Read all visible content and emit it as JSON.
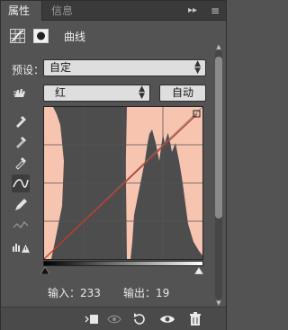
{
  "tabs": [
    {
      "label": "属性",
      "active": true
    },
    {
      "label": "信息",
      "active": false
    }
  ],
  "tab_controls": {
    "collapse": "▸▸",
    "menu": "≡"
  },
  "header": {
    "title": "曲线",
    "icons": [
      "curves-adjustment-icon",
      "layer-mask-icon"
    ]
  },
  "preset": {
    "label": "预设：",
    "value": "自定"
  },
  "channel": {
    "value": "红"
  },
  "auto_button": "自动",
  "tools": [
    "target-adjust-icon",
    "black-eyedropper-icon",
    "gray-eyedropper-icon",
    "white-eyedropper-icon",
    "curve-edit-icon",
    "pencil-draw-icon",
    "smooth-icon",
    "clipping-warning-icon"
  ],
  "input": {
    "label": "输入：",
    "value": "233"
  },
  "output": {
    "label": "输出：",
    "value": "19"
  },
  "bottom_icons": [
    "clip-to-layer-icon",
    "view-previous-icon",
    "reset-icon",
    "visibility-eye-icon",
    "delete-trash-icon"
  ],
  "colors": {
    "panel": "#535353",
    "histogram": "#f7c4b0",
    "histogram_dark": "#4d4d4d",
    "curve": "#c0392b"
  }
}
